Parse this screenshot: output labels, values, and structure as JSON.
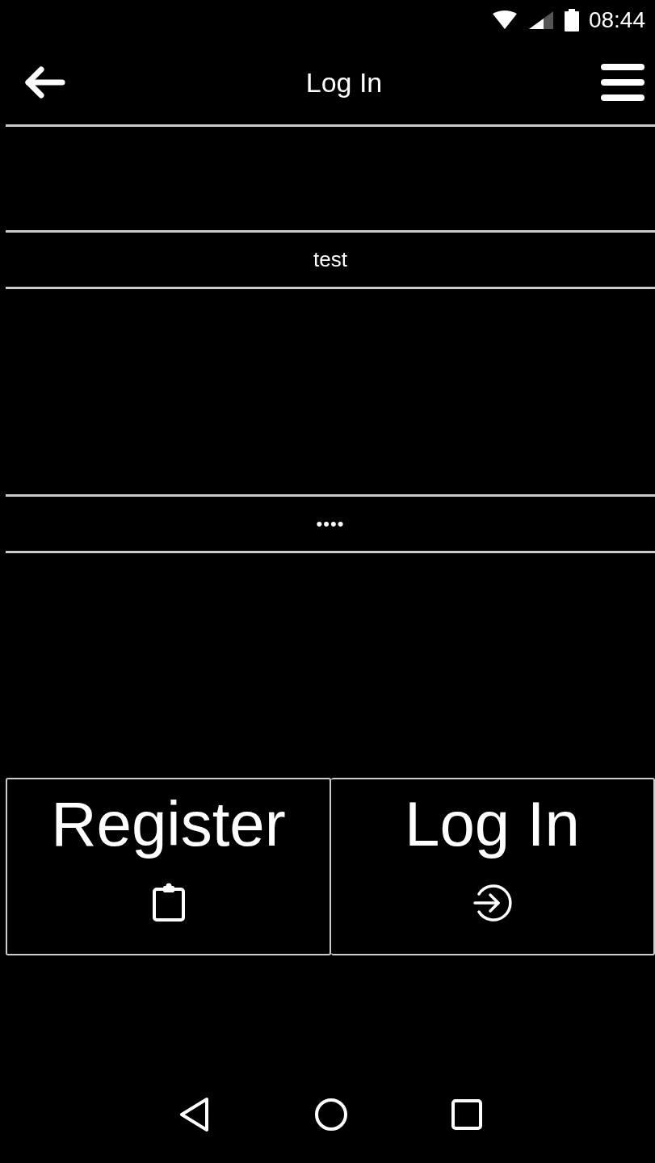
{
  "status_bar": {
    "time": "08:44"
  },
  "toolbar": {
    "title": "Log In"
  },
  "form": {
    "username": {
      "value": "test"
    },
    "password": {
      "value": "••••"
    }
  },
  "actions": [
    {
      "label": "Register",
      "kind": "register"
    },
    {
      "label": "Log In",
      "kind": "login"
    }
  ]
}
